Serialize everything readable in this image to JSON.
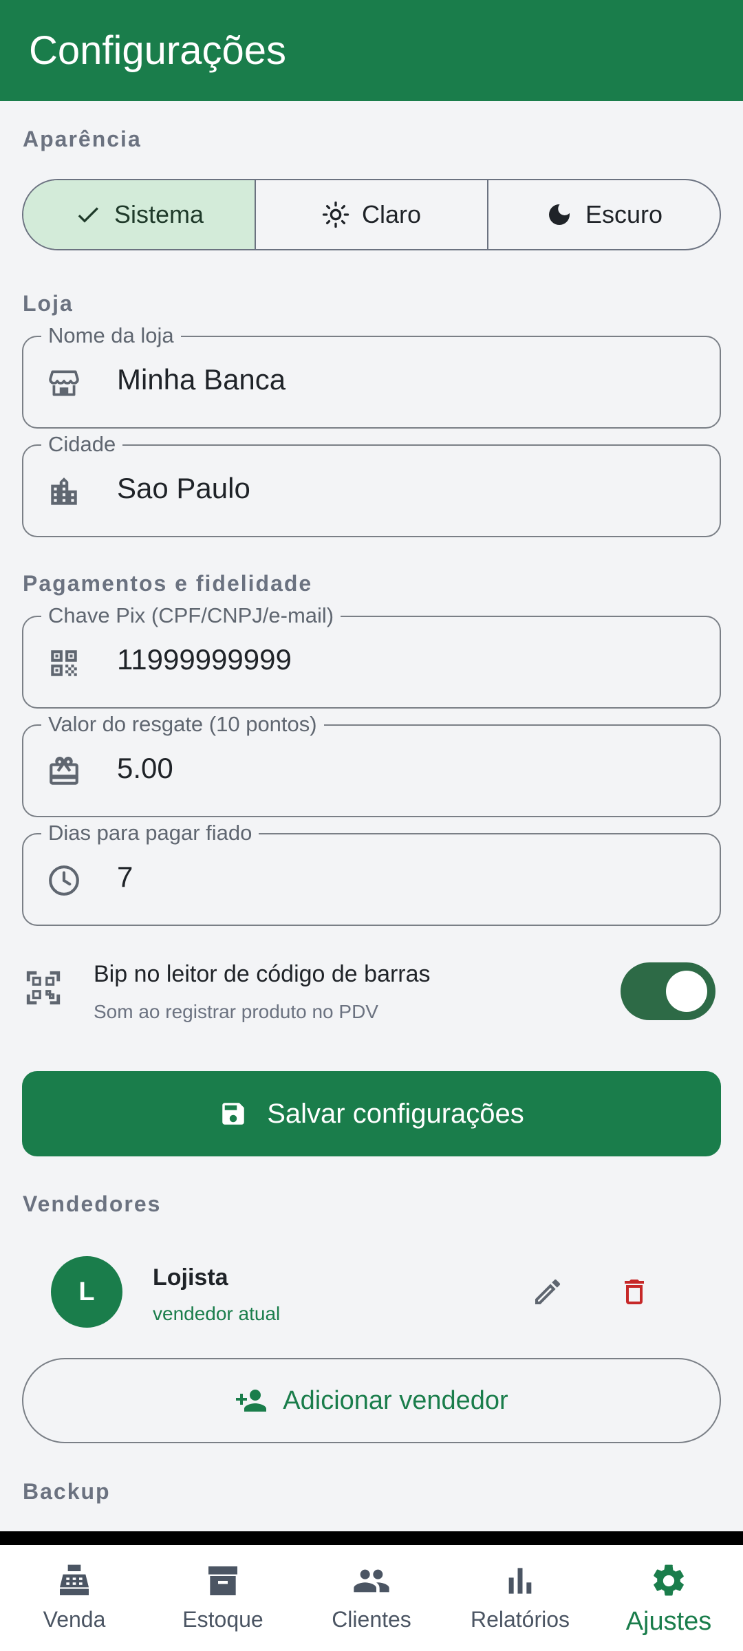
{
  "appbar": {
    "title": "Configurações"
  },
  "appearance": {
    "section_label": "Aparência",
    "options": [
      {
        "label": "Sistema",
        "icon": "check-icon",
        "selected": true
      },
      {
        "label": "Claro",
        "icon": "sun-icon",
        "selected": false
      },
      {
        "label": "Escuro",
        "icon": "moon-icon",
        "selected": false
      }
    ]
  },
  "store": {
    "section_label": "Loja",
    "name": {
      "label": "Nome da loja",
      "value": "Minha Banca",
      "icon": "store-icon"
    },
    "city": {
      "label": "Cidade",
      "value": "Sao Paulo",
      "icon": "city-icon"
    }
  },
  "payments": {
    "section_label": "Pagamentos e fidelidade",
    "pix": {
      "label": "Chave Pix (CPF/CNPJ/e-mail)",
      "value": "11999999999",
      "icon": "qr-code-icon"
    },
    "reward": {
      "label": "Valor do resgate (10 pontos)",
      "value": "5.00",
      "icon": "gift-card-icon"
    },
    "due_days": {
      "label": "Dias para pagar fiado",
      "value": "7",
      "icon": "clock-icon"
    }
  },
  "beep": {
    "title": "Bip no leitor de código de barras",
    "subtitle": "Som ao registrar produto no PDV",
    "enabled": true,
    "icon": "qr-scanner-icon"
  },
  "save_button": {
    "label": "Salvar configurações",
    "icon": "save-icon"
  },
  "sellers": {
    "section_label": "Vendedores",
    "items": [
      {
        "initial": "L",
        "name": "Lojista",
        "subtitle": "vendedor atual"
      }
    ],
    "add_label": "Adicionar vendedor"
  },
  "backup": {
    "section_label": "Backup"
  },
  "colors": {
    "primary": "#1a7d4b",
    "selected_segment": "#d3ebd9",
    "danger": "#c62828",
    "background": "#f3f4f6"
  },
  "bottom_nav": [
    {
      "label": "Venda",
      "icon": "cash-register-icon",
      "active": false
    },
    {
      "label": "Estoque",
      "icon": "archive-box-icon",
      "active": false
    },
    {
      "label": "Clientes",
      "icon": "people-icon",
      "active": false
    },
    {
      "label": "Relatórios",
      "icon": "bar-chart-icon",
      "active": false
    },
    {
      "label": "Ajustes",
      "icon": "settings-gear-icon",
      "active": true
    }
  ]
}
